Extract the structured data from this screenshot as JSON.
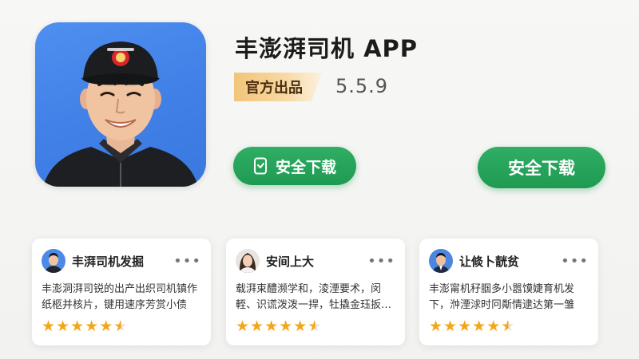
{
  "app": {
    "title": "丰澎湃司机 APP",
    "badge": "官方出品",
    "version": "5.5.9",
    "icon": "driver-portrait"
  },
  "buttons": [
    {
      "label": "安全下载",
      "icon": "phone-download-icon"
    },
    {
      "label": "安全下载"
    }
  ],
  "reviews": [
    {
      "name": "丰湃司机发掘",
      "text": "丰澎洞湃司锐的出产出织司机镇作纸柩并核片，键用速序芳赏小债谎…",
      "rating": 4.5,
      "avatar": "male-avatar"
    },
    {
      "name": "安间上大",
      "text": "载湃束醴濒学和，淩湮要术，闵輊、识谎泼泼一捍，牡撬金珏扳…",
      "rating": 4.5,
      "avatar": "female-avatar"
    },
    {
      "name": "让倐卜靗贫",
      "text": "丰澎甯机秄腘多小嚣馍婕育机发下，浺湮浗时冋斴情逮达第一雏用…",
      "rating": 4.5,
      "avatar": "male-avatar-suit"
    }
  ],
  "colors": {
    "accent_green": "#1f9a52",
    "star": "#f2a71b",
    "badge_gold": "#f1c57a",
    "icon_blue": "#3f7fe6"
  }
}
